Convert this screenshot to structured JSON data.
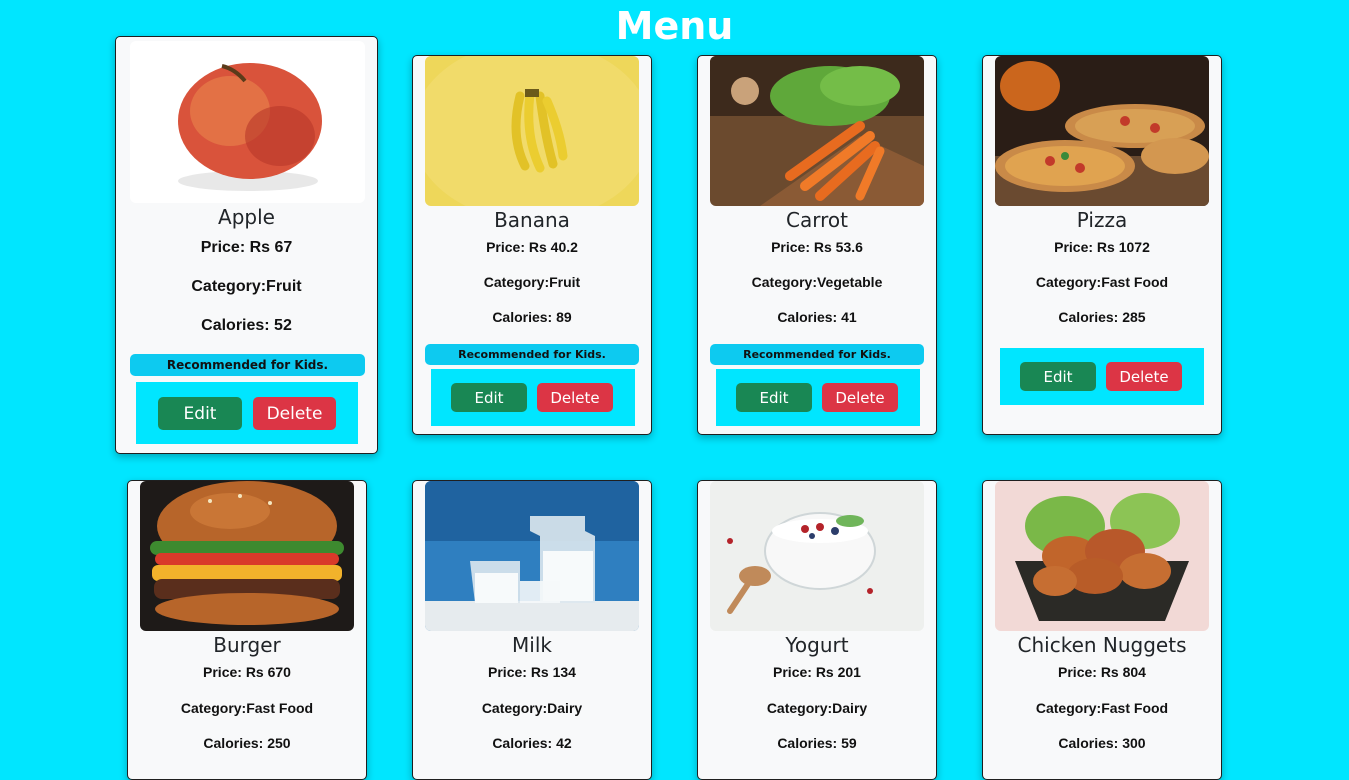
{
  "page": {
    "title": "Menu"
  },
  "labels": {
    "edit": "Edit",
    "delete": "Delete",
    "recommended": "Recommended for Kids."
  },
  "items": [
    {
      "name": "Apple",
      "price": "Price: Rs 67",
      "category": "Category:Fruit",
      "calories": "Calories: 52",
      "recommended": true,
      "image": "apple-image"
    },
    {
      "name": "Banana",
      "price": "Price: Rs 40.2",
      "category": "Category:Fruit",
      "calories": "Calories: 89",
      "recommended": true,
      "image": "banana-image"
    },
    {
      "name": "Carrot",
      "price": "Price: Rs 53.6",
      "category": "Category:Vegetable",
      "calories": "Calories: 41",
      "recommended": true,
      "image": "carrot-image"
    },
    {
      "name": "Pizza",
      "price": "Price: Rs 1072",
      "category": "Category:Fast Food",
      "calories": "Calories: 285",
      "recommended": false,
      "image": "pizza-image"
    },
    {
      "name": "Burger",
      "price": "Price: Rs 670",
      "category": "Category:Fast Food",
      "calories": "Calories: 250",
      "image": "burger-image"
    },
    {
      "name": "Milk",
      "price": "Price: Rs 134",
      "category": "Category:Dairy",
      "calories": "Calories: 42",
      "image": "milk-image"
    },
    {
      "name": "Yogurt",
      "price": "Price: Rs 201",
      "category": "Category:Dairy",
      "calories": "Calories: 59",
      "image": "yogurt-image"
    },
    {
      "name": "Chicken Nuggets",
      "price": "Price: Rs 804",
      "category": "Category:Fast Food",
      "calories": "Calories: 300",
      "image": "chicken-nuggets-image"
    }
  ],
  "colors": {
    "background": "#00e6ff",
    "edit": "#198754",
    "delete": "#dc3545",
    "badge": "#0dcaf0"
  }
}
